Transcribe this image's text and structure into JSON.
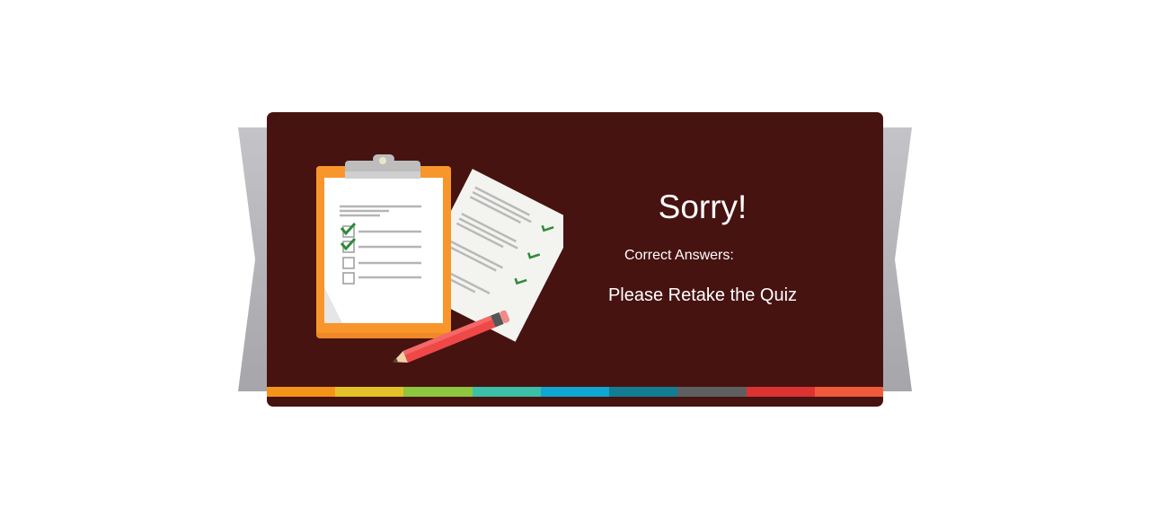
{
  "quiz_result": {
    "title": "Sorry!",
    "correct_answers_label": "Correct Answers:",
    "retake_message": "Please Retake the Quiz"
  },
  "colors": {
    "card_background": "#461311",
    "ribbon": "#b8b8bc",
    "text": "#ffffff",
    "clipboard": "#f8962b",
    "check": "#2e8b3a",
    "pencil": "#f04848"
  },
  "color_bar": [
    "#f39418",
    "#e2c12a",
    "#8dc63f",
    "#3bbfa8",
    "#0fa7d1",
    "#137e93",
    "#5f5f61",
    "#dc3232",
    "#f05a3c"
  ],
  "icons": {
    "illustration": "clipboard-checklist-icon",
    "pencil": "pencil-icon"
  }
}
